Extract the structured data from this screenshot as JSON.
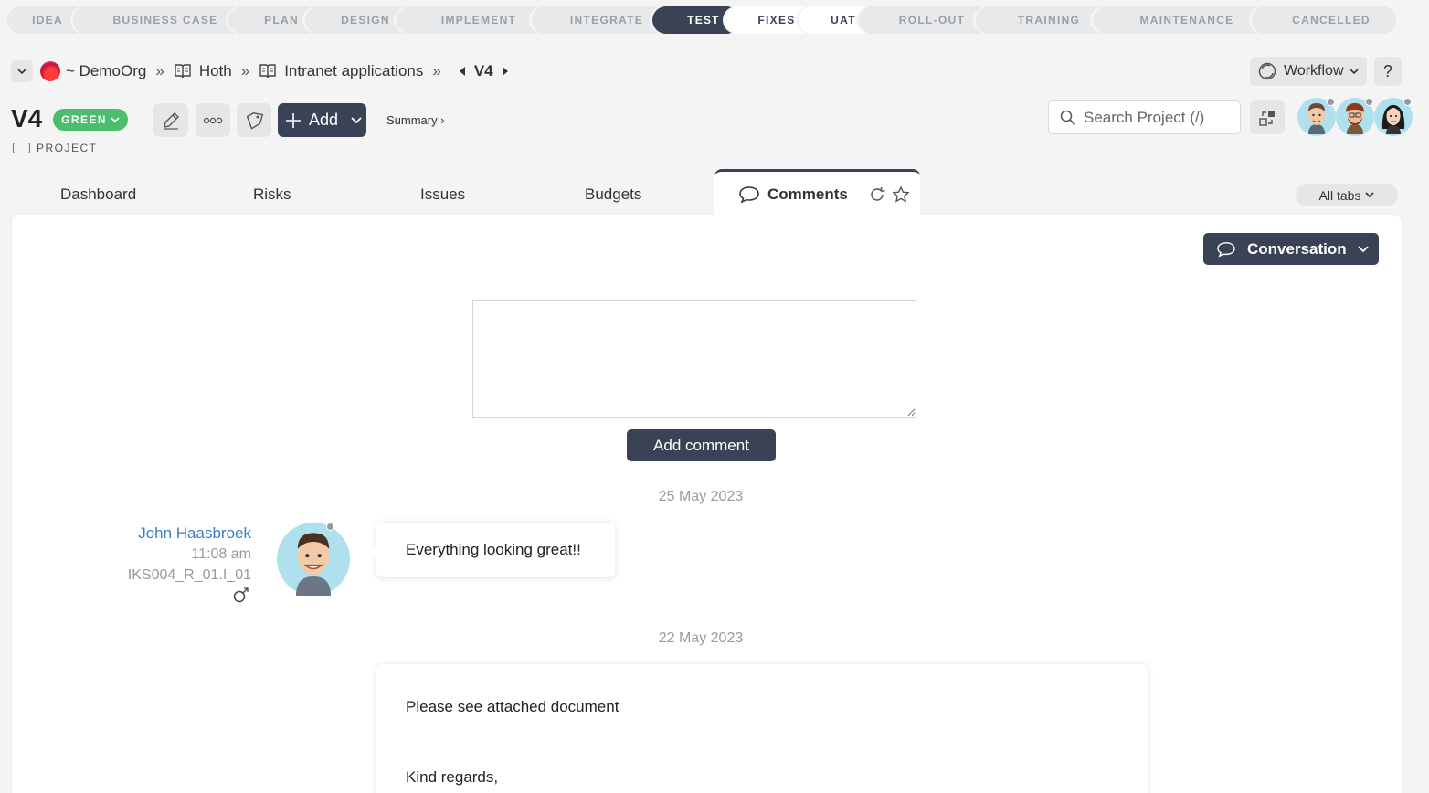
{
  "stages": [
    {
      "label": "IDEA",
      "w": 88
    },
    {
      "label": "BUSINESS CASE",
      "w": 186
    },
    {
      "label": "PLAN",
      "w": 100
    },
    {
      "label": "DESIGN",
      "w": 116
    },
    {
      "label": "IMPLEMENT",
      "w": 164
    },
    {
      "label": "INTEGRATE",
      "w": 148
    },
    {
      "label": "TEST",
      "w": 96
    },
    {
      "label": "FIXES",
      "w": 96
    },
    {
      "label": "UAT",
      "w": 82
    },
    {
      "label": "ROLL-OUT",
      "w": 144
    },
    {
      "label": "TRAINING",
      "w": 144
    },
    {
      "label": "MAINTENANCE",
      "w": 190
    },
    {
      "label": "CANCELLED",
      "w": 158
    }
  ],
  "current_stage": "TEST",
  "breadcrumb": {
    "org": "~ DemoOrg",
    "portfolio": "Hoth",
    "program": "Intranet applications",
    "current": "V4"
  },
  "toolbar": {
    "workflow_label": "Workflow",
    "help_label": "?",
    "add_label": "Add",
    "summary_label": "Summary ›",
    "search_placeholder": "Search Project (/)"
  },
  "project": {
    "title": "V4",
    "status": "GREEN",
    "type": "PROJECT"
  },
  "tabs": {
    "dashboard": "Dashboard",
    "risks": "Risks",
    "issues": "Issues",
    "budgets": "Budgets",
    "comments": "Comments",
    "all_tabs": "All tabs"
  },
  "conversation": {
    "view_label": "Conversation",
    "add_comment_label": "Add comment",
    "groups": [
      {
        "date": "25 May 2023",
        "author": "John Haasbroek",
        "time": "11:08 am",
        "ref": "IKS004_R_01.I_01",
        "text": "Everything looking great!!"
      },
      {
        "date": "22 May 2023",
        "line1": "Please see attached document",
        "line2": "Kind regards,"
      }
    ]
  },
  "colors": {
    "accent": "#3b4255",
    "status_green": "#4bbd6c",
    "link": "#3a7fc0"
  }
}
